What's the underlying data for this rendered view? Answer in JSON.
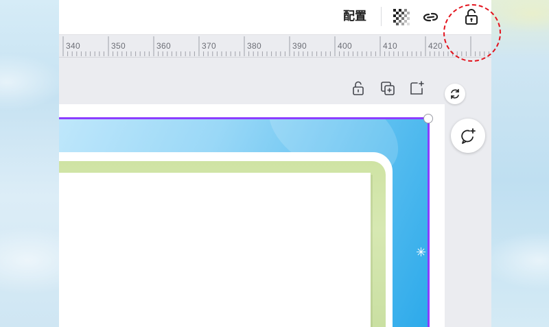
{
  "toolbar": {
    "arrange_label": "配置",
    "icons": [
      "transparency-icon",
      "link-icon",
      "lock-icon"
    ]
  },
  "ruler": {
    "labels": [
      "340",
      "350",
      "360",
      "370",
      "380",
      "390",
      "400",
      "410",
      "420"
    ]
  },
  "page_tools": {
    "icons": [
      "lock-icon",
      "duplicate-page-icon",
      "add-page-icon"
    ]
  },
  "side_controls": {
    "icons": [
      "refresh-icon",
      "add-comment-icon"
    ]
  },
  "colors": {
    "selection": "#8b3dff",
    "highlight_circle": "#e3131d",
    "canvas_blue": "#2ba9ea",
    "frame_green": "#cfe3a4"
  }
}
